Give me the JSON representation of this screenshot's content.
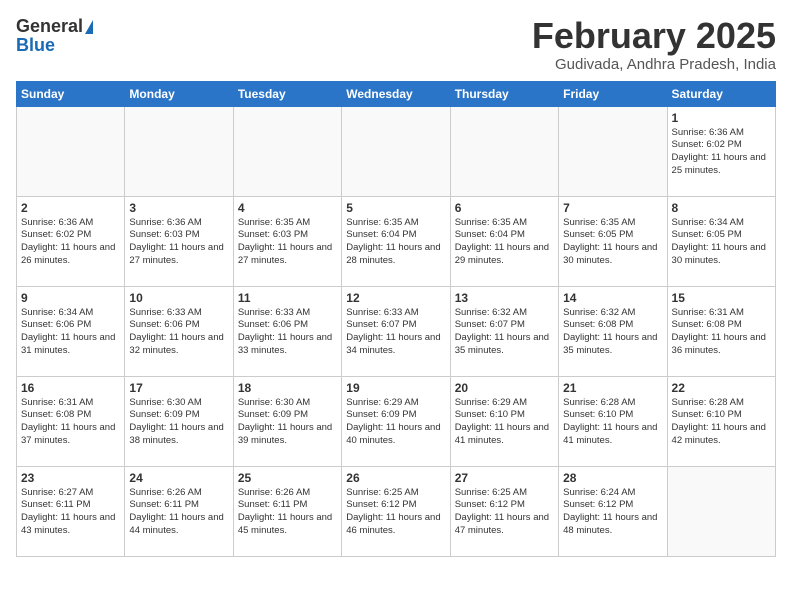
{
  "header": {
    "logo_general": "General",
    "logo_blue": "Blue",
    "title": "February 2025",
    "subtitle": "Gudivada, Andhra Pradesh, India"
  },
  "days_of_week": [
    "Sunday",
    "Monday",
    "Tuesday",
    "Wednesday",
    "Thursday",
    "Friday",
    "Saturday"
  ],
  "weeks": [
    [
      {
        "day": "",
        "sunrise": "",
        "sunset": "",
        "daylight": ""
      },
      {
        "day": "",
        "sunrise": "",
        "sunset": "",
        "daylight": ""
      },
      {
        "day": "",
        "sunrise": "",
        "sunset": "",
        "daylight": ""
      },
      {
        "day": "",
        "sunrise": "",
        "sunset": "",
        "daylight": ""
      },
      {
        "day": "",
        "sunrise": "",
        "sunset": "",
        "daylight": ""
      },
      {
        "day": "",
        "sunrise": "",
        "sunset": "",
        "daylight": ""
      },
      {
        "day": "1",
        "sunrise": "6:36 AM",
        "sunset": "6:02 PM",
        "daylight": "11 hours and 25 minutes."
      }
    ],
    [
      {
        "day": "2",
        "sunrise": "6:36 AM",
        "sunset": "6:02 PM",
        "daylight": "11 hours and 26 minutes."
      },
      {
        "day": "3",
        "sunrise": "6:36 AM",
        "sunset": "6:03 PM",
        "daylight": "11 hours and 27 minutes."
      },
      {
        "day": "4",
        "sunrise": "6:35 AM",
        "sunset": "6:03 PM",
        "daylight": "11 hours and 27 minutes."
      },
      {
        "day": "5",
        "sunrise": "6:35 AM",
        "sunset": "6:04 PM",
        "daylight": "11 hours and 28 minutes."
      },
      {
        "day": "6",
        "sunrise": "6:35 AM",
        "sunset": "6:04 PM",
        "daylight": "11 hours and 29 minutes."
      },
      {
        "day": "7",
        "sunrise": "6:35 AM",
        "sunset": "6:05 PM",
        "daylight": "11 hours and 30 minutes."
      },
      {
        "day": "8",
        "sunrise": "6:34 AM",
        "sunset": "6:05 PM",
        "daylight": "11 hours and 30 minutes."
      }
    ],
    [
      {
        "day": "9",
        "sunrise": "6:34 AM",
        "sunset": "6:06 PM",
        "daylight": "11 hours and 31 minutes."
      },
      {
        "day": "10",
        "sunrise": "6:33 AM",
        "sunset": "6:06 PM",
        "daylight": "11 hours and 32 minutes."
      },
      {
        "day": "11",
        "sunrise": "6:33 AM",
        "sunset": "6:06 PM",
        "daylight": "11 hours and 33 minutes."
      },
      {
        "day": "12",
        "sunrise": "6:33 AM",
        "sunset": "6:07 PM",
        "daylight": "11 hours and 34 minutes."
      },
      {
        "day": "13",
        "sunrise": "6:32 AM",
        "sunset": "6:07 PM",
        "daylight": "11 hours and 35 minutes."
      },
      {
        "day": "14",
        "sunrise": "6:32 AM",
        "sunset": "6:08 PM",
        "daylight": "11 hours and 35 minutes."
      },
      {
        "day": "15",
        "sunrise": "6:31 AM",
        "sunset": "6:08 PM",
        "daylight": "11 hours and 36 minutes."
      }
    ],
    [
      {
        "day": "16",
        "sunrise": "6:31 AM",
        "sunset": "6:08 PM",
        "daylight": "11 hours and 37 minutes."
      },
      {
        "day": "17",
        "sunrise": "6:30 AM",
        "sunset": "6:09 PM",
        "daylight": "11 hours and 38 minutes."
      },
      {
        "day": "18",
        "sunrise": "6:30 AM",
        "sunset": "6:09 PM",
        "daylight": "11 hours and 39 minutes."
      },
      {
        "day": "19",
        "sunrise": "6:29 AM",
        "sunset": "6:09 PM",
        "daylight": "11 hours and 40 minutes."
      },
      {
        "day": "20",
        "sunrise": "6:29 AM",
        "sunset": "6:10 PM",
        "daylight": "11 hours and 41 minutes."
      },
      {
        "day": "21",
        "sunrise": "6:28 AM",
        "sunset": "6:10 PM",
        "daylight": "11 hours and 41 minutes."
      },
      {
        "day": "22",
        "sunrise": "6:28 AM",
        "sunset": "6:10 PM",
        "daylight": "11 hours and 42 minutes."
      }
    ],
    [
      {
        "day": "23",
        "sunrise": "6:27 AM",
        "sunset": "6:11 PM",
        "daylight": "11 hours and 43 minutes."
      },
      {
        "day": "24",
        "sunrise": "6:26 AM",
        "sunset": "6:11 PM",
        "daylight": "11 hours and 44 minutes."
      },
      {
        "day": "25",
        "sunrise": "6:26 AM",
        "sunset": "6:11 PM",
        "daylight": "11 hours and 45 minutes."
      },
      {
        "day": "26",
        "sunrise": "6:25 AM",
        "sunset": "6:12 PM",
        "daylight": "11 hours and 46 minutes."
      },
      {
        "day": "27",
        "sunrise": "6:25 AM",
        "sunset": "6:12 PM",
        "daylight": "11 hours and 47 minutes."
      },
      {
        "day": "28",
        "sunrise": "6:24 AM",
        "sunset": "6:12 PM",
        "daylight": "11 hours and 48 minutes."
      },
      {
        "day": "",
        "sunrise": "",
        "sunset": "",
        "daylight": ""
      }
    ]
  ]
}
